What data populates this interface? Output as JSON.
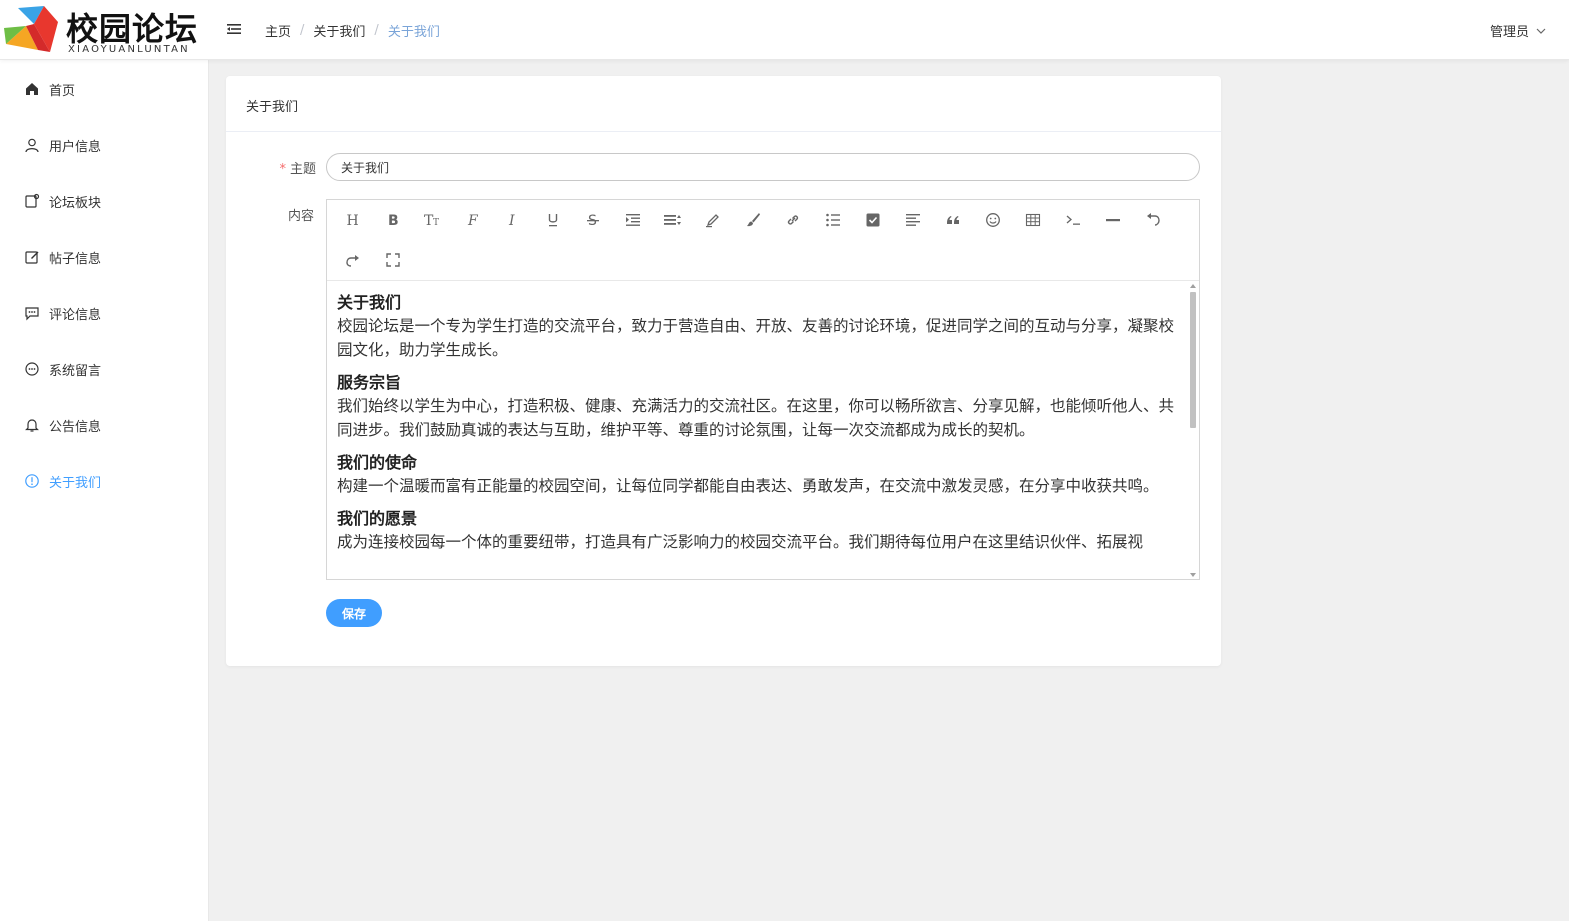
{
  "app": {
    "logo_title": "校园论坛",
    "logo_subtitle": "XIAOYUANLUNTAN"
  },
  "header": {
    "breadcrumb": [
      "主页",
      "关于我们",
      "关于我们"
    ],
    "breadcrumb_separator": "/",
    "user": "管理员"
  },
  "sidebar": {
    "items": [
      {
        "label": "首页",
        "icon": "home-icon"
      },
      {
        "label": "用户信息",
        "icon": "user-icon"
      },
      {
        "label": "论坛板块",
        "icon": "board-icon"
      },
      {
        "label": "帖子信息",
        "icon": "edit-icon"
      },
      {
        "label": "评论信息",
        "icon": "comment-icon"
      },
      {
        "label": "系统留言",
        "icon": "chat-icon"
      },
      {
        "label": "公告信息",
        "icon": "bell-icon"
      },
      {
        "label": "关于我们",
        "icon": "info-icon",
        "active": true
      }
    ]
  },
  "card": {
    "title": "关于我们",
    "subject_label": "主题",
    "subject_required_mark": "*",
    "subject_value": "关于我们",
    "content_label": "内容",
    "save_label": "保存"
  },
  "editor": {
    "toolbar": [
      "heading-icon",
      "bold-icon",
      "font-size-icon",
      "font-family-icon",
      "italic-icon",
      "underline-icon",
      "strikethrough-icon",
      "indent-icon",
      "line-height-icon",
      "font-color-icon",
      "background-color-icon",
      "link-icon",
      "list-icon",
      "todo-icon",
      "justify-icon",
      "quote-icon",
      "emoticon-icon",
      "table-icon",
      "code-icon",
      "divider-icon",
      "undo-icon",
      "redo-icon",
      "fullscreen-icon"
    ],
    "sections": [
      {
        "heading": "关于我们",
        "body": "校园论坛是一个专为学生打造的交流平台，致力于营造自由、开放、友善的讨论环境，促进同学之间的互动与分享，凝聚校园文化，助力学生成长。"
      },
      {
        "heading": "服务宗旨",
        "body": "我们始终以学生为中心，打造积极、健康、充满活力的交流社区。在这里，你可以畅所欲言、分享见解，也能倾听他人、共同进步。我们鼓励真诚的表达与互助，维护平等、尊重的讨论氛围，让每一次交流都成为成长的契机。"
      },
      {
        "heading": "我们的使命",
        "body": "构建一个温暖而富有正能量的校园空间，让每位同学都能自由表达、勇敢发声，在交流中激发灵感，在分享中收获共鸣。"
      },
      {
        "heading": "我们的愿景",
        "body": "成为连接校园每一个体的重要纽带，打造具有广泛影响力的校园交流平台。我们期待每位用户在这里结识伙伴、拓展视"
      }
    ]
  },
  "colors": {
    "accent": "#409eff",
    "breadcrumb_active": "#7aa4d8",
    "required": "#f56c6c"
  }
}
